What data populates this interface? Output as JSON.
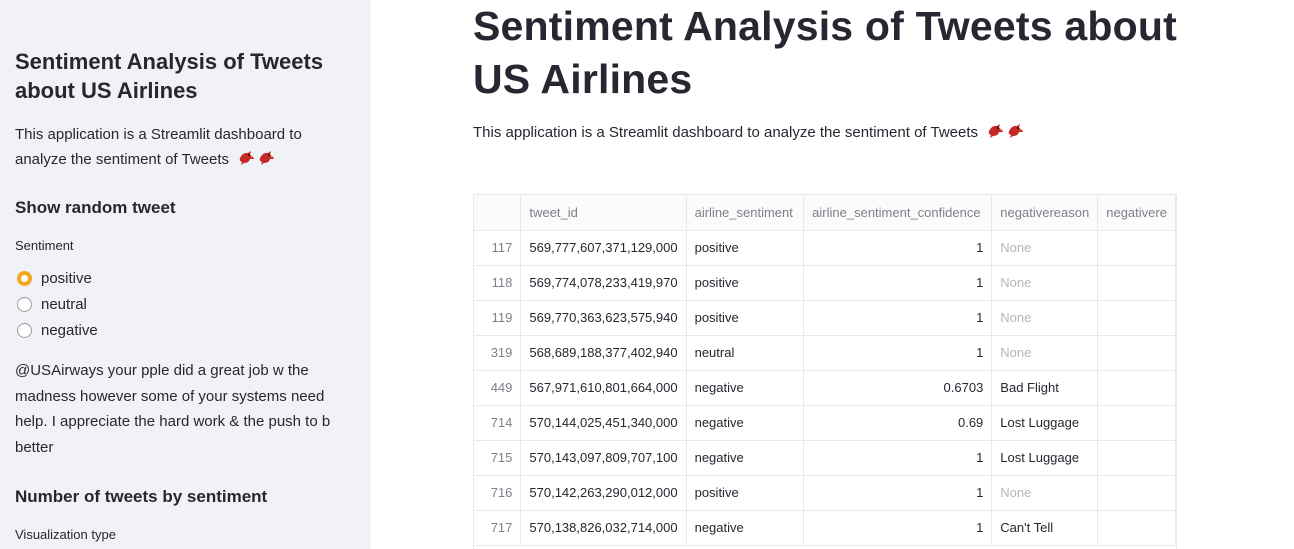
{
  "sidebar": {
    "title": "Sentiment Analysis of Tweets about US Airlines",
    "description": "This application is a Streamlit dashboard to analyze the sentiment of Tweets",
    "random_tweet_header": "Show random tweet",
    "sentiment_label": "Sentiment",
    "sentiment_options": [
      "positive",
      "neutral",
      "negative"
    ],
    "selected_sentiment": "positive",
    "random_tweet_text": "@USAirways your pple did a great job w the madness however some of your systems need help. I appreciate the hard work & the push to b better",
    "count_header": "Number of tweets by sentiment",
    "viz_type_label": "Visualization type"
  },
  "main": {
    "title": "Sentiment Analysis of Tweets about US Airlines",
    "description": "This application is a Streamlit dashboard to analyze the sentiment of Tweets",
    "emoji_icon": "cardinal-bird-icon"
  },
  "table": {
    "columns": [
      "",
      "tweet_id",
      "airline_sentiment",
      "airline_sentiment_confidence",
      "negativereason",
      "negativere"
    ],
    "rows": [
      {
        "idx": "117",
        "tweet_id": "569,777,607,371,129,000",
        "sentiment": "positive",
        "confidence": "1",
        "reason": "None"
      },
      {
        "idx": "118",
        "tweet_id": "569,774,078,233,419,970",
        "sentiment": "positive",
        "confidence": "1",
        "reason": "None"
      },
      {
        "idx": "119",
        "tweet_id": "569,770,363,623,575,940",
        "sentiment": "positive",
        "confidence": "1",
        "reason": "None"
      },
      {
        "idx": "319",
        "tweet_id": "568,689,188,377,402,940",
        "sentiment": "neutral",
        "confidence": "1",
        "reason": "None"
      },
      {
        "idx": "449",
        "tweet_id": "567,971,610,801,664,000",
        "sentiment": "negative",
        "confidence": "0.6703",
        "reason": "Bad Flight"
      },
      {
        "idx": "714",
        "tweet_id": "570,144,025,451,340,000",
        "sentiment": "negative",
        "confidence": "0.69",
        "reason": "Lost Luggage"
      },
      {
        "idx": "715",
        "tweet_id": "570,143,097,809,707,100",
        "sentiment": "negative",
        "confidence": "1",
        "reason": "Lost Luggage"
      },
      {
        "idx": "716",
        "tweet_id": "570,142,263,290,012,000",
        "sentiment": "positive",
        "confidence": "1",
        "reason": "None"
      },
      {
        "idx": "717",
        "tweet_id": "570,138,826,032,714,000",
        "sentiment": "negative",
        "confidence": "1",
        "reason": "Can't Tell"
      }
    ]
  },
  "colors": {
    "accent": "#f5a623",
    "sidebar_bg": "#f0f2f6",
    "text": "#262730"
  }
}
